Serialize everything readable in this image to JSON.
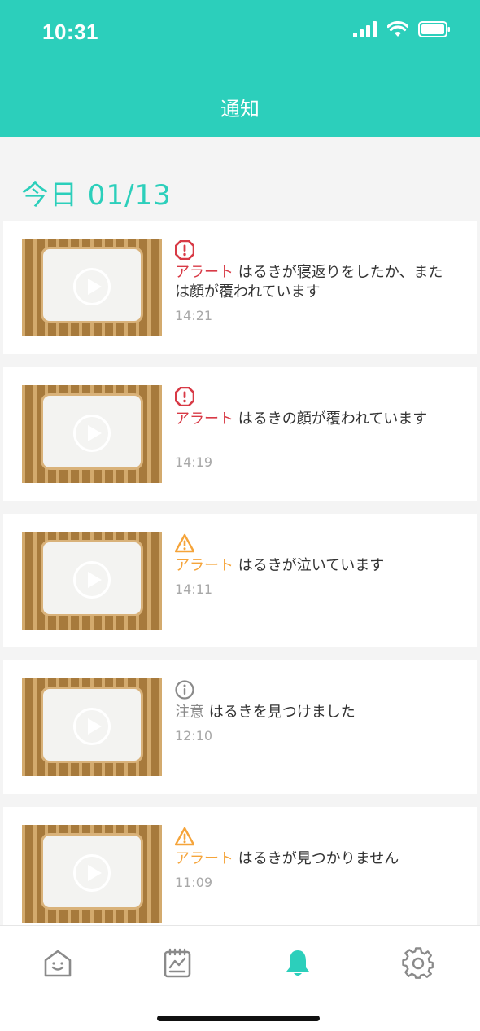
{
  "status": {
    "time": "10:31"
  },
  "header": {
    "title": "通知"
  },
  "date_heading": "今日 01/13",
  "notifications": [
    {
      "severity": "alert-red",
      "tag": "アラート",
      "message": "はるきが寝返りをしたか、または顔が覆われています",
      "time": "14:21"
    },
    {
      "severity": "alert-red",
      "tag": "アラート",
      "message": "はるきの顔が覆われています",
      "time": "14:19"
    },
    {
      "severity": "alert-orange",
      "tag": "アラート",
      "message": "はるきが泣いています",
      "time": "14:11"
    },
    {
      "severity": "info",
      "tag": "注意",
      "message": "はるきを見つけました",
      "time": "12:10"
    },
    {
      "severity": "alert-orange",
      "tag": "アラート",
      "message": "はるきが見つかりません",
      "time": "11:09"
    }
  ],
  "tabs": [
    {
      "name": "home",
      "icon": "home-face-icon",
      "active": false
    },
    {
      "name": "log",
      "icon": "clipboard-chart-icon",
      "active": false
    },
    {
      "name": "notifications",
      "icon": "bell-icon",
      "active": true
    },
    {
      "name": "settings",
      "icon": "gear-icon",
      "active": false
    }
  ],
  "colors": {
    "accent": "#2ccfbb",
    "alert_red": "#d83a46",
    "alert_orange": "#f5a43a",
    "info_gray": "#8a8a8a"
  }
}
